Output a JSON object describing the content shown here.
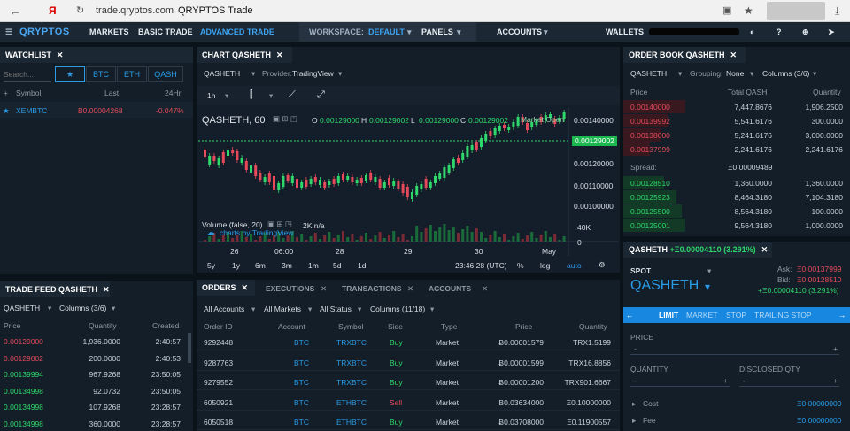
{
  "browser": {
    "url": "trade.qryptos.com",
    "title": "QRYPTOS Trade",
    "yandex": "Я"
  },
  "nav": {
    "logo": "QRYPTOS",
    "items": [
      "MARKETS",
      "BASIC TRADE",
      "ADVANCED TRADE"
    ],
    "workspace_label": "WORKSPACE:",
    "workspace_value": "DEFAULT",
    "panels": "PANELS",
    "accounts": "ACCOUNTS",
    "wallets": "WALLETS"
  },
  "watchlist": {
    "title": "WATCHLIST",
    "search_placeholder": "Search...",
    "star": "★",
    "tabs": [
      "BTC",
      "ETH",
      "QASH"
    ],
    "cols": [
      "Symbol",
      "Last",
      "24Hr"
    ],
    "rows": [
      {
        "symbol": "XEMBTC",
        "last": "Ƀ0.00004268",
        "change": "-0.047%"
      }
    ]
  },
  "chart": {
    "title": "CHART QASHETH",
    "pair": "QASHETH",
    "provider_label": "Provider:",
    "provider": "TradingView",
    "interval": "1h",
    "legend": "QASHETH, 60",
    "o_label": "O",
    "o": "0.00129000",
    "h_label": "H",
    "h": "0.00129002",
    "l_label": "L",
    "l": "0.00129000",
    "c_label": "C",
    "c": "0.00129002",
    "market_open": "Market Open",
    "last_price": "0.00129002",
    "volume_label": "Volume (false, 20)",
    "volume_val": "2K n/a",
    "watermark": "charts by TradingView",
    "price_ticks": [
      "0.00140000",
      "0.00120000",
      "0.00110000",
      "0.00100000",
      "40K",
      "0"
    ],
    "time_ticks": [
      "26",
      "06:00",
      "28",
      "29",
      "30",
      "May"
    ],
    "ranges": [
      "5y",
      "1y",
      "6m",
      "3m",
      "1m",
      "5d",
      "1d"
    ],
    "time": "23:46:28 (UTC)",
    "pct": "%",
    "log": "log",
    "auto": "auto"
  },
  "chart_data": {
    "type": "candlestick",
    "series": [
      {
        "name": "QASHETH"
      },
      {
        "name": "Volume"
      }
    ],
    "last": 0.00129002
  },
  "orderbook": {
    "title": "ORDER BOOK QASHETH",
    "pair": "QASHETH",
    "grouping_label": "Grouping:",
    "grouping": "None",
    "columns": "Columns (3/6)",
    "cols": [
      "Price",
      "Total QASH",
      "Quantity"
    ],
    "asks": [
      {
        "price": "0.00140000",
        "total": "7,447.8676",
        "qty": "1,906.2500"
      },
      {
        "price": "0.00139992",
        "total": "5,541.6176",
        "qty": "300.0000"
      },
      {
        "price": "0.00138000",
        "total": "5,241.6176",
        "qty": "3,000.0000"
      },
      {
        "price": "0.00137999",
        "total": "2,241.6176",
        "qty": "2,241.6176"
      }
    ],
    "spread_label": "Spread:",
    "spread": "Ξ0.00009489",
    "bids": [
      {
        "price": "0.00128510",
        "total": "1,360.0000",
        "qty": "1,360.0000"
      },
      {
        "price": "0.00125923",
        "total": "8,464.3180",
        "qty": "7,104.3180"
      },
      {
        "price": "0.00125500",
        "total": "8,564.3180",
        "qty": "100.0000"
      },
      {
        "price": "0.00125001",
        "total": "9,564.3180",
        "qty": "1,000.0000"
      }
    ]
  },
  "order_form": {
    "tab_title": "QASHETH",
    "tab_change": "+Ξ0.00004110 (3.291%)",
    "spot": "SPOT",
    "pair": "QASHETH",
    "ask_label": "Ask:",
    "ask": "Ξ0.00137999",
    "bid_label": "Bid:",
    "bid": "Ξ0.00128510",
    "change": "+Ξ0.00004110 (3.291%)",
    "types": [
      "LIMIT",
      "MARKET",
      "STOP",
      "TRAILING STOP"
    ],
    "price_label": "PRICE",
    "qty_label": "QUANTITY",
    "disclosed_label": "DISCLOSED QTY",
    "dash": "-",
    "plus": "+",
    "cost_label": "Cost",
    "cost": "Ξ0.00000000",
    "fee_label": "Fee",
    "fee": "Ξ0.00000000"
  },
  "tradefeed": {
    "title": "TRADE FEED QASHETH",
    "pair": "QASHETH",
    "columns": "Columns (3/6)",
    "cols": [
      "Price",
      "Quantity",
      "Created"
    ],
    "rows": [
      {
        "price": "0.00129000",
        "qty": "1,936.0000",
        "time": "2:40:57",
        "side": "sell"
      },
      {
        "price": "0.00129002",
        "qty": "200.0000",
        "time": "2:40:53",
        "side": "sell"
      },
      {
        "price": "0.00139994",
        "qty": "967.9268",
        "time": "23:50:05",
        "side": "buy"
      },
      {
        "price": "0.00134998",
        "qty": "92.0732",
        "time": "23:50:05",
        "side": "buy"
      },
      {
        "price": "0.00134998",
        "qty": "107.9268",
        "time": "23:28:57",
        "side": "buy"
      },
      {
        "price": "0.00134998",
        "qty": "360.0000",
        "time": "23:28:57",
        "side": "buy"
      }
    ]
  },
  "orders": {
    "tabs": [
      "ORDERS",
      "EXECUTIONS",
      "TRANSACTIONS",
      "ACCOUNTS"
    ],
    "filters": [
      "All Accounts",
      "All Markets",
      "All Status",
      "Columns (11/18)"
    ],
    "cols": [
      "Order ID",
      "Account",
      "Symbol",
      "Side",
      "Type",
      "Price",
      "Quantity"
    ],
    "rows": [
      {
        "id": "9292448",
        "account": "BTC",
        "symbol": "TRXBTC",
        "side": "Buy",
        "type": "Market",
        "price": "Ƀ0.00001579",
        "qty": "TRX1.5199"
      },
      {
        "id": "9287763",
        "account": "BTC",
        "symbol": "TRXBTC",
        "side": "Buy",
        "type": "Market",
        "price": "Ƀ0.00001599",
        "qty": "TRX16.8856"
      },
      {
        "id": "9279552",
        "account": "BTC",
        "symbol": "TRXBTC",
        "side": "Buy",
        "type": "Market",
        "price": "Ƀ0.00001200",
        "qty": "TRX901.6667"
      },
      {
        "id": "6050921",
        "account": "BTC",
        "symbol": "ETHBTC",
        "side": "Sell",
        "type": "Market",
        "price": "Ƀ0.03634000",
        "qty": "Ξ0.10000000"
      },
      {
        "id": "6050518",
        "account": "BTC",
        "symbol": "ETHBTC",
        "side": "Buy",
        "type": "Market",
        "price": "Ƀ0.03708000",
        "qty": "Ξ0.11900557"
      }
    ]
  },
  "colors": {
    "green": "#2fd86a",
    "red": "#e64a5a",
    "blue": "#2b9be6",
    "bg": "#131e28"
  }
}
